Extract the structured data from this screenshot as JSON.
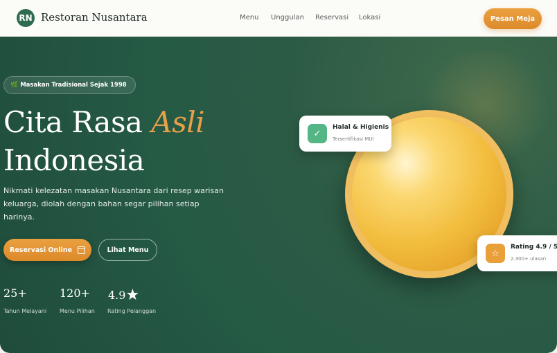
{
  "nav": {
    "logo_initials": "RN",
    "brand": "Restoran Nusantara",
    "links": [
      "Menu",
      "Unggulan",
      "Reservasi",
      "Lokasi"
    ],
    "cta": "Pesan Meja"
  },
  "hero": {
    "badge": "Masakan Tradisional Sejak 1998",
    "title_part1": "Cita Rasa ",
    "title_accent": "Asli",
    "title_line2": "Indonesia",
    "description": "Nikmati kelezatan masakan Nusantara dari resep warisan keluarga, diolah dengan bahan segar pilihan setiap harinya.",
    "primary_button": "Reservasi Online",
    "secondary_button": "Lihat Menu",
    "stats": [
      {
        "value": "25+",
        "label": "Tahun Melayani"
      },
      {
        "value": "120+",
        "label": "Menu Pilihan"
      },
      {
        "value": "4.9",
        "label": "Rating Pelanggan"
      }
    ]
  },
  "cards": {
    "halal": {
      "title": "Halal & Higienis",
      "subtitle": "Tersertifikasi MUI"
    },
    "rating": {
      "title": "Rating 4.9 / 5",
      "subtitle": "2.300+ ulasan"
    }
  },
  "icons": {
    "badge": "leaf-icon",
    "primary_button": "calendar-icon",
    "halal": "check-icon",
    "rating": "star-icon"
  },
  "colors": {
    "brand_green": "#2f6b4f",
    "accent_orange": "#e9a038",
    "hero_green": "#255a45"
  }
}
